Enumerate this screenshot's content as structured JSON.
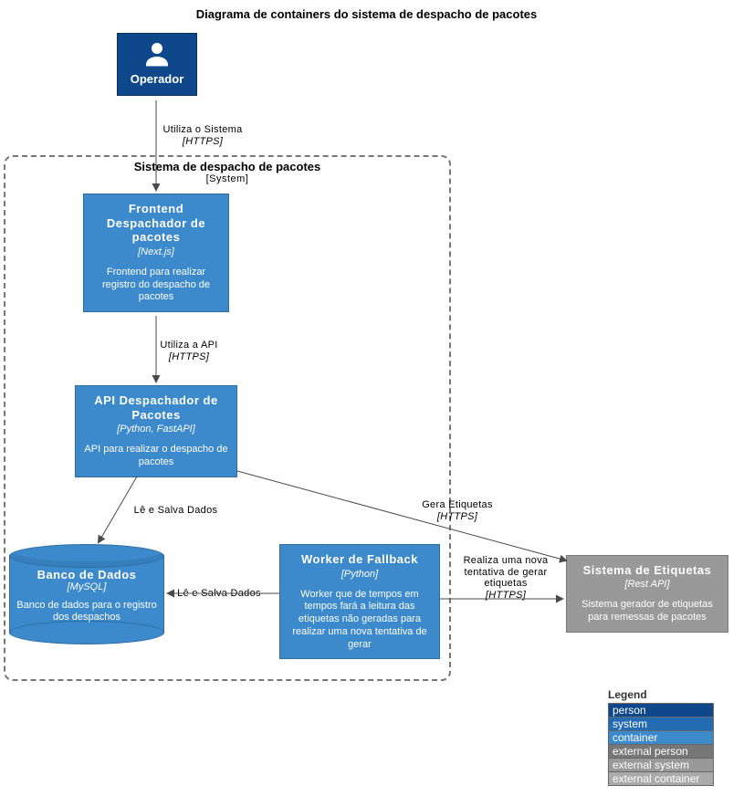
{
  "title": "Diagrama de containers do sistema de despacho de pacotes",
  "person": {
    "label": "Operador"
  },
  "boundary": {
    "name": "Sistema de despacho de pacotes",
    "type": "[System]"
  },
  "frontend": {
    "name": "Frontend Despachador de pacotes",
    "tech": "[Next.js]",
    "desc": "Frontend para realizar registro do despacho de pacotes"
  },
  "api": {
    "name": "API Despachador de Pacotes",
    "tech": "[Python, FastAPI]",
    "desc": "API para realizar o despacho de pacotes"
  },
  "worker": {
    "name": "Worker de Fallback",
    "tech": "[Python]",
    "desc": "Worker que de tempos em tempos fará a leitura das etiquetas não geradas para realizar uma nova tentativa de gerar"
  },
  "db": {
    "name": "Banco de Dados",
    "tech": "[MySQL]",
    "desc": "Banco de dados para o registro dos despachos"
  },
  "etiquetas": {
    "name": "Sistema de Etiquetas",
    "tech": "[Rest API]",
    "desc": "Sistema gerador de etiquetas para remessas de pacotes"
  },
  "rels": {
    "utilizaSistema": {
      "label": "Utiliza o Sistema",
      "proto": "[HTTPS]"
    },
    "utilizaApi": {
      "label": "Utiliza a API",
      "proto": "[HTTPS]"
    },
    "leSalva1": {
      "label": "Lê e Salva Dados"
    },
    "leSalva2": {
      "label": "Lê e Salva Dados"
    },
    "geraEtiquetas": {
      "label": "Gera Etiquetas",
      "proto": "[HTTPS]"
    },
    "retryEtiquetas": {
      "label": "Realiza uma nova tentativa de gerar etiquetas",
      "proto": "[HTTPS]"
    }
  },
  "legend": {
    "title": "Legend",
    "items": {
      "person": "person",
      "system": "system",
      "container": "container",
      "extPerson": "external person",
      "extSystem": "external system",
      "extContainer": "external container"
    }
  }
}
